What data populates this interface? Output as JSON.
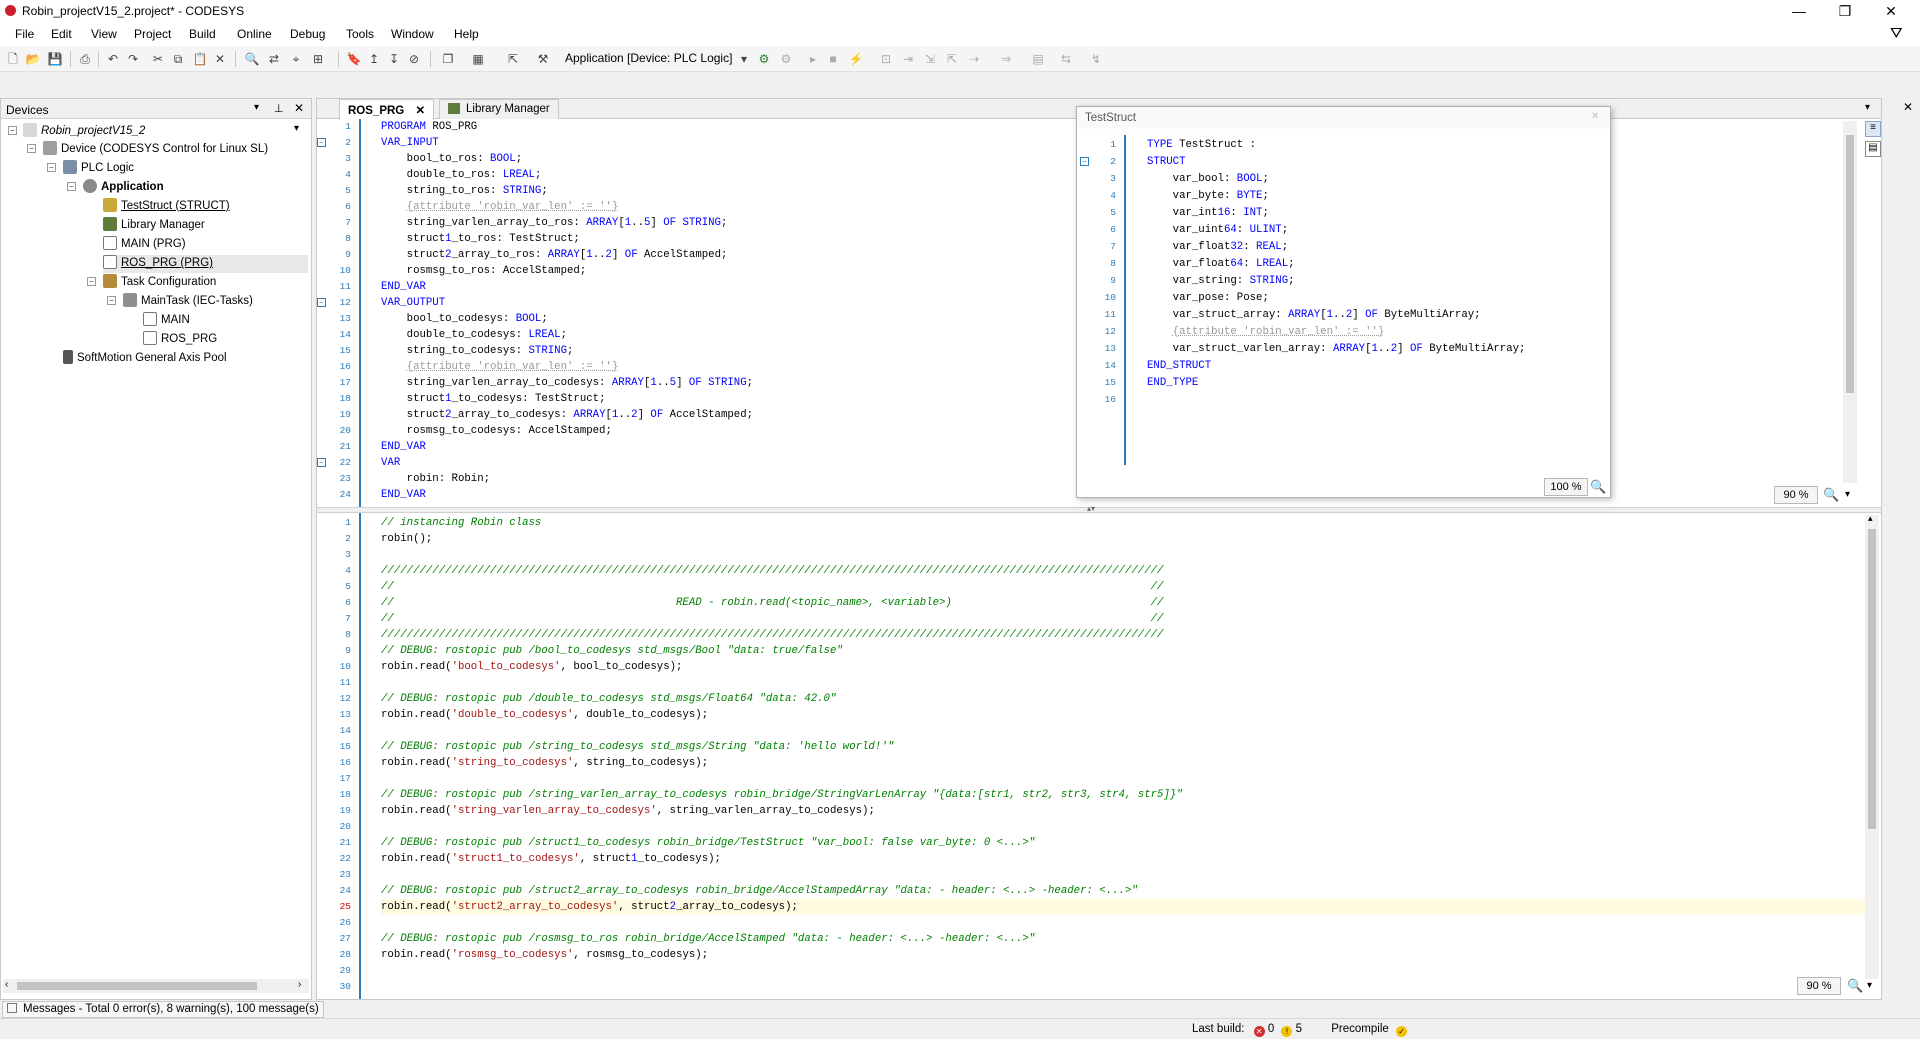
{
  "window": {
    "title": "Robin_projectV15_2.project* - CODESYS",
    "minimize": "—",
    "restore": "❐",
    "close": "✕"
  },
  "menu": [
    "File",
    "Edit",
    "View",
    "Project",
    "Build",
    "Online",
    "Debug",
    "Tools",
    "Window",
    "Help"
  ],
  "toolbar": {
    "active_application": "Application [Device: PLC Logic]"
  },
  "devices": {
    "title": "Devices",
    "tree": [
      {
        "label": "Robin_projectV15_2",
        "icon": "project-icon"
      },
      {
        "label": "Device (CODESYS Control for Linux SL)",
        "icon": "device-icon"
      },
      {
        "label": "PLC Logic",
        "icon": "plc-icon"
      },
      {
        "label": "Application",
        "icon": "gear-icon"
      },
      {
        "label": "TestStruct (STRUCT)",
        "icon": "struct-icon"
      },
      {
        "label": "Library Manager",
        "icon": "library-icon"
      },
      {
        "label": "MAIN (PRG)",
        "icon": "pou-icon"
      },
      {
        "label": "ROS_PRG (PRG)",
        "icon": "pou-icon"
      },
      {
        "label": "Task Configuration",
        "icon": "task-config-icon"
      },
      {
        "label": "MainTask (IEC-Tasks)",
        "icon": "task-icon"
      },
      {
        "label": "MAIN",
        "icon": "program-call-icon"
      },
      {
        "label": "ROS_PRG",
        "icon": "program-call-icon"
      },
      {
        "label": "SoftMotion General Axis Pool",
        "icon": "axis-pool-icon"
      }
    ]
  },
  "tabs": [
    {
      "label": "ROS_PRG",
      "close": "✕"
    },
    {
      "label": "Library Manager"
    }
  ],
  "decl": {
    "lines": [
      "PROGRAM ROS_PRG",
      "VAR_INPUT",
      "    bool_to_ros: BOOL;",
      "    double_to_ros: LREAL;",
      "    string_to_ros: STRING;",
      "    {attribute 'robin_var_len' := ''}",
      "    string_varlen_array_to_ros: ARRAY[1..5] OF STRING;",
      "    struct1_to_ros: TestStruct;",
      "    struct2_array_to_ros: ARRAY[1..2] OF AccelStamped;",
      "    rosmsg_to_ros: AccelStamped;",
      "END_VAR",
      "VAR_OUTPUT",
      "    bool_to_codesys: BOOL;",
      "    double_to_codesys: LREAL;",
      "    string_to_codesys: STRING;",
      "    {attribute 'robin_var_len' := ''}",
      "    string_varlen_array_to_codesys: ARRAY[1..5] OF STRING;",
      "    struct1_to_codesys: TestStruct;",
      "    struct2_array_to_codesys: ARRAY[1..2] OF AccelStamped;",
      "    rosmsg_to_codesys: AccelStamped;",
      "END_VAR",
      "VAR",
      "    robin: Robin;",
      "END_VAR"
    ],
    "zoom": "90 %"
  },
  "impl": {
    "lines": [
      "// instancing Robin class",
      "robin();",
      "",
      "//////////////////////////////////////////////////////////////////////////////////////////////////////////////////////////",
      "//                                                                                                                      //",
      "//                                            READ - robin.read(<topic_name>, <variable>)                               //",
      "//                                                                                                                      //",
      "//////////////////////////////////////////////////////////////////////////////////////////////////////////////////////////",
      "// DEBUG: rostopic pub /bool_to_codesys std_msgs/Bool \"data: true/false\"",
      "robin.read('bool_to_codesys', bool_to_codesys);",
      "",
      "// DEBUG: rostopic pub /double_to_codesys std_msgs/Float64 \"data: 42.0\"",
      "robin.read('double_to_codesys', double_to_codesys);",
      "",
      "// DEBUG: rostopic pub /string_to_codesys std_msgs/String \"data: 'hello world!'\"",
      "robin.read('string_to_codesys', string_to_codesys);",
      "",
      "// DEBUG: rostopic pub /string_varlen_array_to_codesys robin_bridge/StringVarLenArray \"{data:[str1, str2, str3, str4, str5]}\"",
      "robin.read('string_varlen_array_to_codesys', string_varlen_array_to_codesys);",
      "",
      "// DEBUG: rostopic pub /struct1_to_codesys robin_bridge/TestStruct \"var_bool: false var_byte: 0 <...>\"",
      "robin.read('struct1_to_codesys', struct1_to_codesys);",
      "",
      "// DEBUG: rostopic pub /struct2_array_to_codesys robin_bridge/AccelStampedArray \"data: - header: <...> -header: <...>\"",
      "robin.read('struct2_array_to_codesys', struct2_array_to_codesys);",
      "",
      "// DEBUG: rostopic pub /rosmsg_to_ros robin_bridge/AccelStamped \"data: - header: <...> -header: <...>\"",
      "robin.read('rosmsg_to_codesys', rosmsg_to_codesys);",
      "",
      ""
    ],
    "current_line": "25",
    "zoom": "90 %"
  },
  "struct_popup": {
    "title": "TestStruct",
    "close": "✕",
    "lines": [
      "TYPE TestStruct :",
      "STRUCT",
      "    var_bool: BOOL;",
      "    var_byte: BYTE;",
      "    var_int16: INT;",
      "    var_uint64: ULINT;",
      "    var_float32: REAL;",
      "    var_float64: LREAL;",
      "    var_string: STRING;",
      "    var_pose: Pose;",
      "    var_struct_array: ARRAY[1..2] OF ByteMultiArray;",
      "    {attribute 'robin_var_len' := ''}",
      "    var_struct_varlen_array: ARRAY[1..2] OF ByteMultiArray;",
      "END_STRUCT",
      "END_TYPE",
      ""
    ],
    "zoom": "100 %"
  },
  "messages": "Messages - Total 0 error(s), 8 warning(s), 100 message(s)",
  "status": {
    "last_build_label": "Last build:",
    "errors": "0",
    "warnings": "5",
    "precompile_label": "Precompile",
    "precompile_state": "✓"
  },
  "colors": {
    "keyword": "#0000ff",
    "comment": "#008000",
    "string": "#a31515",
    "line_number": "#2b7bb9",
    "current_line_bg": "#fffbe0"
  }
}
